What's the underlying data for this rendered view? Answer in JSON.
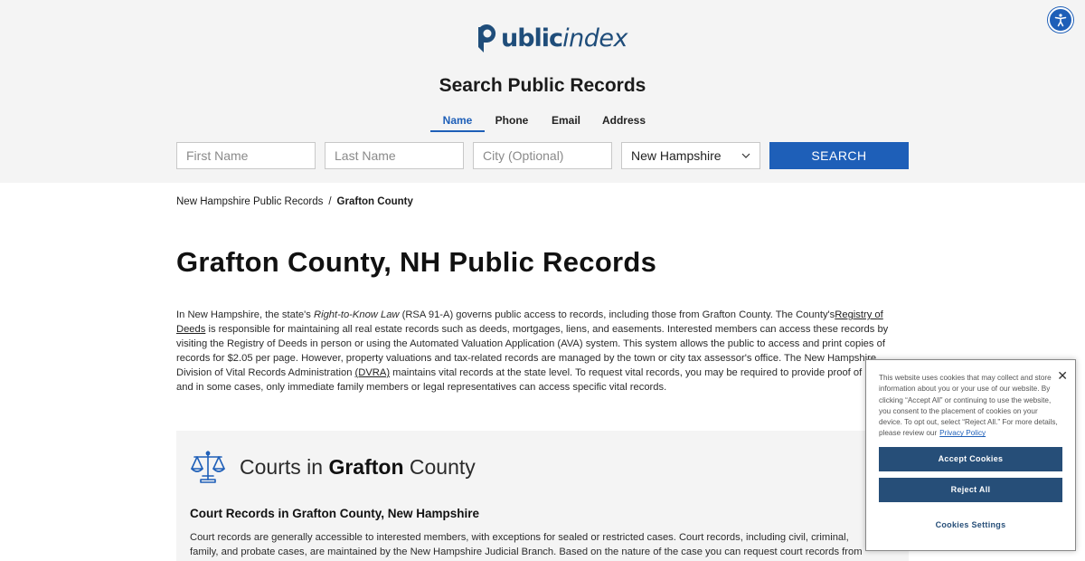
{
  "brand": {
    "logo_bold": "ublic",
    "logo_italic": "index",
    "color": "#1f4d7a"
  },
  "accessibility": {
    "icon": "accessibility-icon"
  },
  "search": {
    "title": "Search Public Records",
    "tabs": [
      {
        "label": "Name",
        "active": true
      },
      {
        "label": "Phone",
        "active": false
      },
      {
        "label": "Email",
        "active": false
      },
      {
        "label": "Address",
        "active": false
      }
    ],
    "first_name_placeholder": "First Name",
    "last_name_placeholder": "Last Name",
    "city_placeholder": "City (Optional)",
    "state_selected": "New Hampshire",
    "button_label": "SEARCH",
    "accent": "#1e5fb8"
  },
  "breadcrumb": {
    "parent": "New Hampshire Public Records",
    "separator": "/",
    "current": "Grafton County"
  },
  "page_title": "Grafton County, NH Public Records",
  "intro": {
    "p1": "In New Hampshire, the state's ",
    "law_name": "Right-to-Know Law",
    "p2": " (RSA 91-A) governs public access to records, including those from Grafton County. The County's",
    "registry_link": "Registry of Deeds",
    "p3": " is responsible for maintaining all real estate records such as deeds, mortgages, liens, and easements. Interested members can access these records by visiting the Registry of Deeds in person or using the Automated Valuation Application (AVA) system. This system allows the public to access and print copies of records for $2.05 per page. However, property valuations and tax-related records are managed by the town or city tax assessor's office. The New Hampshire Division of Vital Records Administration ",
    "dvra_link": "(DVRA)",
    "p4": " maintains vital records at the state level. To request vital records, you may be required to provide proof of identity, and in some cases, only immediate family members or legal representatives can access specific vital records."
  },
  "courts": {
    "heading_prefix": "Courts in",
    "heading_county": "Grafton",
    "heading_suffix": "County",
    "icon": "scales-icon",
    "subtitle": "Court Records in Grafton County, New Hampshire",
    "text": "Court records are generally accessible to interested members, with exceptions for sealed or restricted cases. Court records, including civil, criminal, family, and probate cases, are maintained by the New Hampshire Judicial Branch. Based on the nature of the case you can request court records from"
  },
  "cookie": {
    "text": "This website uses cookies that may collect and store information about you or your use of our website. By clicking “Accept All” or continuing to use the website, you consent to the placement of cookies on your device. To opt out, select “Reject All.” For more details, please review our",
    "privacy_link": "Privacy Policy",
    "accept_label": "Accept Cookies",
    "reject_label": "Reject All",
    "settings_label": "Cookies Settings",
    "close_symbol": "✕",
    "button_color": "#264e78"
  }
}
